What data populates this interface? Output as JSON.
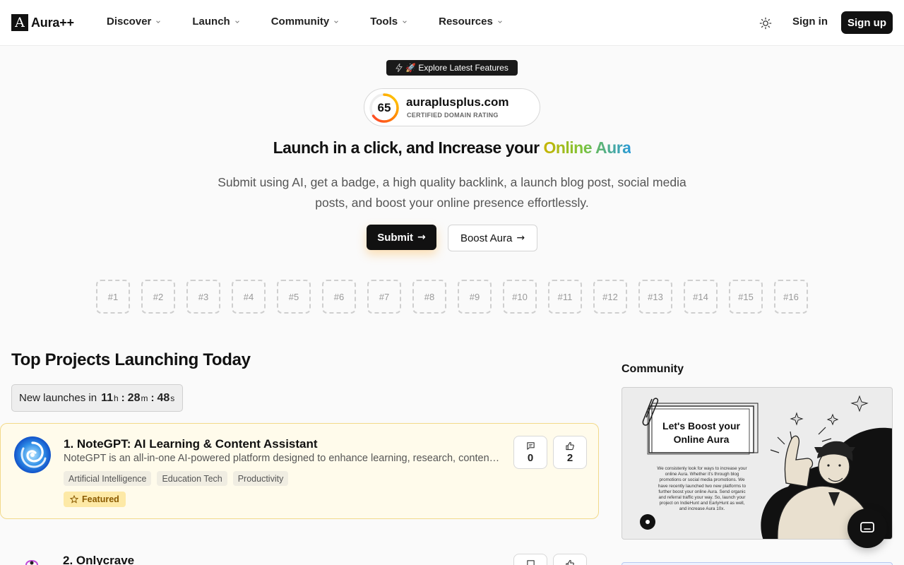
{
  "header": {
    "logo_mark": "A",
    "logo_text": "Aura++",
    "nav": [
      {
        "label": "Discover"
      },
      {
        "label": "Launch"
      },
      {
        "label": "Community"
      },
      {
        "label": "Tools"
      },
      {
        "label": "Resources"
      }
    ],
    "signin_label": "Sign in",
    "signup_label": "Sign up",
    "theme_icon": "sun-icon"
  },
  "hero": {
    "pill_label": "🚀 Explore Latest Features",
    "domain": {
      "score": "65",
      "score_fraction": 0.65,
      "name": "auraplusplus.com",
      "caption": "CERTIFIED DOMAIN RATING"
    },
    "headline_prefix": "Launch in a click, and Increase your ",
    "headline_highlight": "Online Aura",
    "subtext": "Submit using AI, get a badge, a high quality backlink, a launch blog post, social media posts, and boost your online presence effortlessly.",
    "submit_label": "Submit",
    "boost_label": "Boost Aura",
    "slots": [
      "#1",
      "#2",
      "#3",
      "#4",
      "#5",
      "#6",
      "#7",
      "#8",
      "#9",
      "#10",
      "#11",
      "#12",
      "#13",
      "#14",
      "#15",
      "#16"
    ]
  },
  "projects": {
    "title": "Top Projects Launching Today",
    "countdown": {
      "label": "New launches in",
      "hours": "11",
      "hours_unit": "h",
      "minutes": "28",
      "minutes_unit": "m",
      "seconds": "48",
      "seconds_unit": "s"
    },
    "items": [
      {
        "title": "1. NoteGPT: AI Learning & Content Assistant",
        "description": "NoteGPT is an all-in-one AI-powered platform designed to enhance learning, research, content creation and productivity.",
        "tags": [
          "Artificial Intelligence",
          "Education Tech",
          "Productivity"
        ],
        "featured_label": "Featured",
        "comments": "0",
        "upvotes": "2"
      },
      {
        "title": "2. Onlycrave"
      }
    ]
  },
  "community": {
    "title": "Community",
    "card_headline": "Let's Boost your Online Aura",
    "card_body": "We consistenly look for ways to increase your online Aura. Whether it's through blog promotions or social media promotions. We have recently launched two new platforms to further boost your online Aura. Send organic and referral traffic your way. So, launch your project on IndieHunt and EarlyHunt as well, and increase Aura 10x."
  },
  "colors": {
    "accent_dark": "#111111",
    "featured_bg": "#fffbeb",
    "featured_border": "#f2d98a",
    "headline_gradient": [
      "#c9b400",
      "#7cc43a",
      "#2a9ad8"
    ]
  }
}
